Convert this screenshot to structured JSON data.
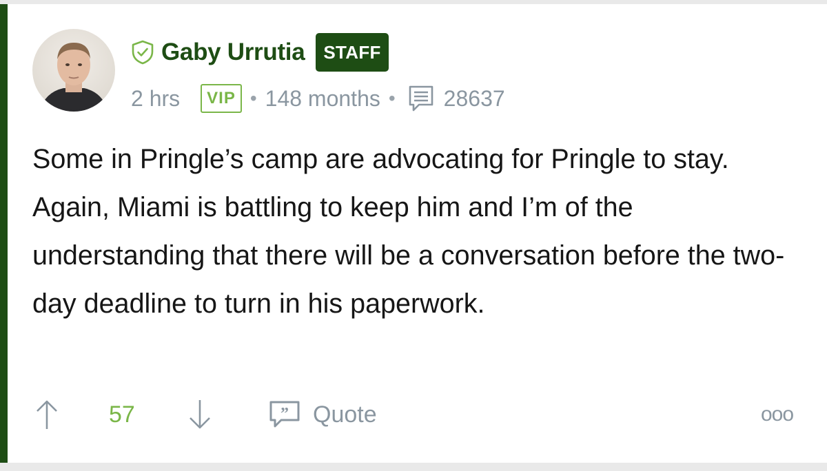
{
  "post": {
    "author": {
      "name": "Gaby Urrutia",
      "badge": "STAFF",
      "verified_icon": "shield-check-icon"
    },
    "meta": {
      "time": "2 hrs",
      "tier": "VIP",
      "membership": "148 months",
      "post_count": "28637",
      "post_count_icon": "comment-lines-icon"
    },
    "body": "Some in Pringle’s camp are advocating for Pringle to stay. Again, Miami is battling to keep him and I’m of the understanding that there will be a conversation before the two-day deadline to turn in his paperwork.",
    "actions": {
      "upvote_icon": "arrow-up-icon",
      "vote_count": "57",
      "downvote_icon": "arrow-down-icon",
      "quote_label": "Quote",
      "quote_icon": "quote-bubble-icon",
      "more_label": "ooo"
    }
  },
  "colors": {
    "brand_green": "#1e4d14",
    "accent_green": "#7ab648",
    "meta_gray": "#8a96a0",
    "text": "#161616"
  }
}
